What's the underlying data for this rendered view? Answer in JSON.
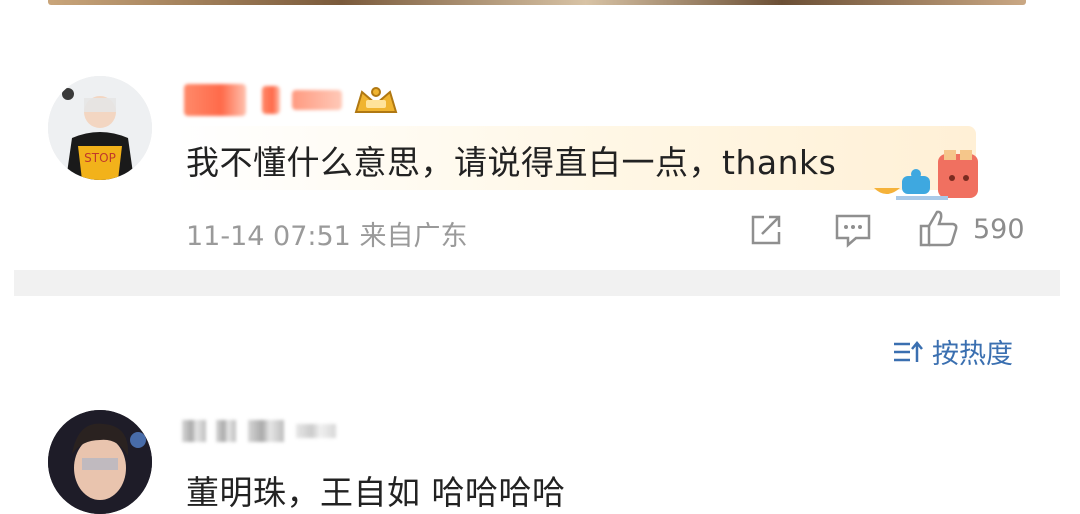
{
  "comments": [
    {
      "text": "我不懂什么意思，请说得直白一点，thanks",
      "time": "11-14 07:51",
      "location": "来自广东",
      "likes": "590"
    },
    {
      "text": "董明珠，王自如 哈哈哈哈"
    }
  ],
  "sort": {
    "label": "按热度"
  },
  "colors": {
    "accent": "#3a6fb0",
    "meta_gray": "#9a9a9a",
    "divider": "#f1f1f1"
  },
  "icons": [
    "share-icon",
    "comment-icon",
    "like-icon",
    "sort-icon",
    "vip-badge-icon",
    "breakfast-sticker-icon"
  ]
}
